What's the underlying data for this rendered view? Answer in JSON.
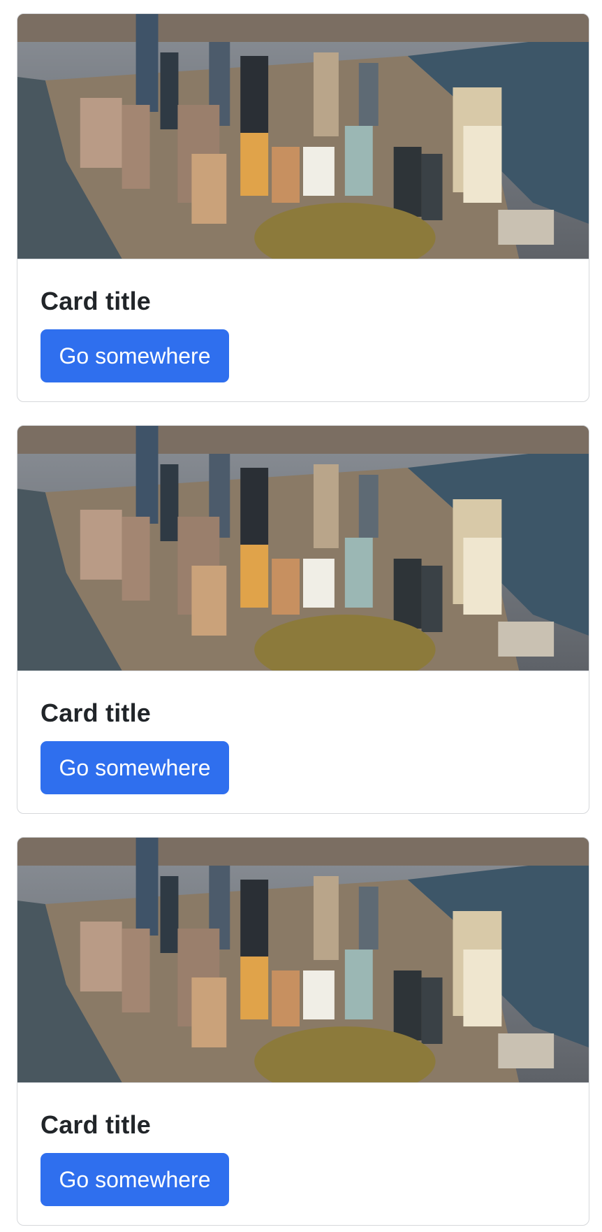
{
  "cards": [
    {
      "image_alt": "Aerial view of Lower Manhattan skyline",
      "title": "Card title",
      "button_label": "Go somewhere"
    },
    {
      "image_alt": "Aerial view of Lower Manhattan skyline",
      "title": "Card title",
      "button_label": "Go somewhere"
    },
    {
      "image_alt": "Aerial view of Lower Manhattan skyline",
      "title": "Card title",
      "button_label": "Go somewhere"
    }
  ],
  "colors": {
    "button_bg": "#2f6fee",
    "title_text": "#212529",
    "card_border": "#d6d8db"
  }
}
